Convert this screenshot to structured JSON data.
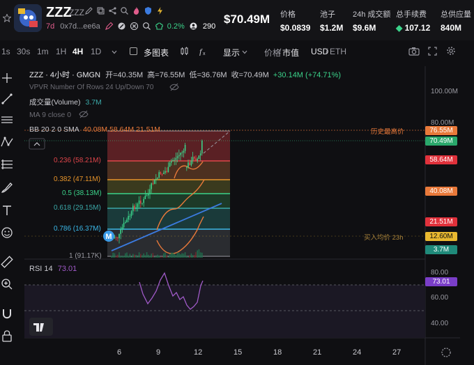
{
  "header": {
    "title": "ZZZ",
    "subtitle": "ZZZ",
    "age": "7d",
    "address": "0x7d...ee6a",
    "change_pct": "0.2%",
    "holders": "290",
    "price": "$70.49M",
    "stats": [
      {
        "label": "价格",
        "value": "$0.0839"
      },
      {
        "label": "池子",
        "value": "$1.2M"
      },
      {
        "label": "24h 成交额",
        "value": "$9.6M"
      },
      {
        "label": "总手续费",
        "value": "107.12"
      },
      {
        "label": "总供应量",
        "value": "840M"
      }
    ]
  },
  "toolbar": {
    "timeframes": [
      "1s",
      "30s",
      "1m",
      "1H",
      "4H",
      "1D"
    ],
    "active_timeframe": "4H",
    "multi_chart": "多图表",
    "display": "显示",
    "price_label": "价格",
    "mcap_label": "市值",
    "divider": "/",
    "usd": "USD",
    "eth": "ETH",
    "eth_sep": "/"
  },
  "legend": {
    "symbol": "ZZZ · 4小时 · GMGN",
    "open_label": "开=40.35M",
    "high_label": "高=76.55M",
    "low_label": "低=36.76M",
    "close_label": "收=70.49M",
    "change": "+30.14M (+74.71%)",
    "vpvr": "VPVR Number Of Rows 24 Up/Down 70",
    "volume_label": "成交量(Volume)",
    "volume_value": "3.7M",
    "ma": "MA 9 close 0",
    "bb": "BB 20 2 0 SMA",
    "bb_values": "40.08M  58.64M  21.51M",
    "ath": "历史最高价",
    "avg_buy": "买入均价 23h"
  },
  "price_axis": {
    "ticks": [
      "100.00M",
      "80.00M"
    ],
    "tags": [
      {
        "text": "76.55M",
        "color": "#e8793a"
      },
      {
        "text": "70.49M",
        "color": "#2aa86b"
      },
      {
        "text": "58.64M",
        "color": "#e0313b"
      },
      {
        "text": "40.08M",
        "color": "#e8793a"
      },
      {
        "text": "21.51M",
        "color": "#e0313b"
      },
      {
        "text": "12.60M",
        "color": "#e8b830"
      },
      {
        "text": "3.7M",
        "color": "#1f8a7a"
      }
    ]
  },
  "fib": [
    {
      "label": "0.236 (58.21M)",
      "color": "#e0454a"
    },
    {
      "label": "0.382 (47.11M)",
      "color": "#e8952a"
    },
    {
      "label": "0.5 (38.13M)",
      "color": "#3bd38a"
    },
    {
      "label": "0.618 (29.15M)",
      "color": "#3ba8a8"
    },
    {
      "label": "0.786 (16.37M)",
      "color": "#3bb8e8"
    },
    {
      "label": "1 (91.17K)",
      "color": "#9a9aa2"
    }
  ],
  "rsi": {
    "label": "RSI 14",
    "value": "73.01",
    "ticks": [
      "80.00",
      "60.00",
      "40.00"
    ]
  },
  "x_axis": [
    "6",
    "9",
    "12",
    "15",
    "18",
    "21",
    "24",
    "27"
  ]
}
